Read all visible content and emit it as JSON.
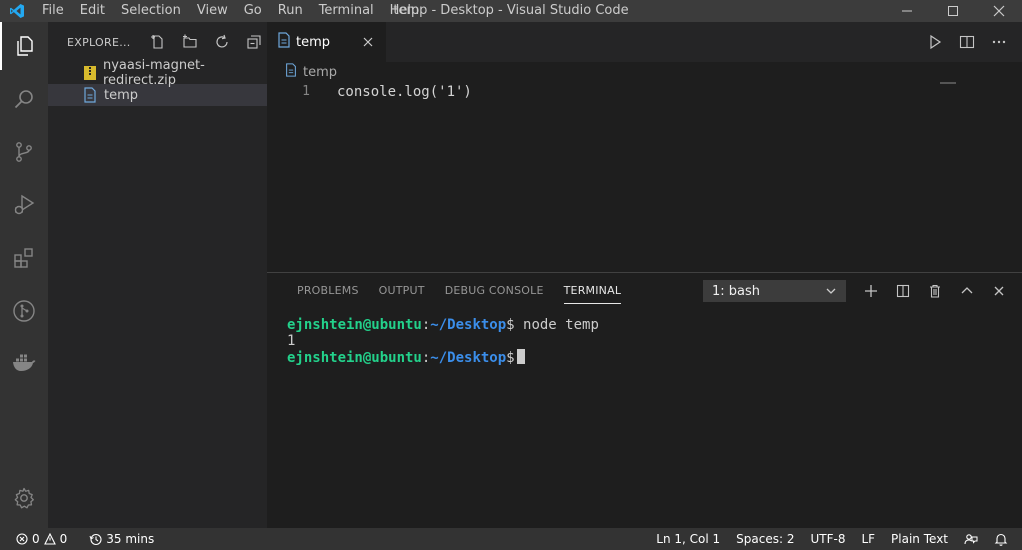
{
  "window": {
    "title": "temp - Desktop - Visual Studio Code",
    "menu": [
      "File",
      "Edit",
      "Selection",
      "View",
      "Go",
      "Run",
      "Terminal",
      "Help"
    ]
  },
  "colors": {
    "accent": "#007acc",
    "activity_bar": "#333333",
    "sidebar": "#252526",
    "editor": "#1e1e1e",
    "terminal_user": "#23d18b",
    "terminal_path": "#3b8eea"
  },
  "activity_bar": {
    "items": [
      "files-icon",
      "search-icon",
      "source-control-icon",
      "run-debug-icon",
      "extensions-icon",
      "git-graph-icon",
      "docker-icon"
    ],
    "bottom": "settings-gear-icon"
  },
  "sidebar": {
    "title": "EXPLORE...",
    "files": [
      {
        "name": "nyaasi-magnet-redirect.zip",
        "icon": "zip-file-icon"
      },
      {
        "name": "temp",
        "icon": "file-icon"
      }
    ]
  },
  "editor": {
    "tab": "temp",
    "breadcrumb": "temp",
    "lines": [
      {
        "num": "1",
        "code": "console.log('1')"
      }
    ]
  },
  "panel": {
    "tabs": [
      "PROBLEMS",
      "OUTPUT",
      "DEBUG CONSOLE",
      "TERMINAL"
    ],
    "active_tab": "TERMINAL",
    "terminal_select": "1: bash",
    "terminal": {
      "user": "ejnshtein@ubuntu",
      "sep": ":",
      "path": "~/Desktop",
      "prompt": "$",
      "cmd1": " node temp",
      "output": "1"
    }
  },
  "statusbar": {
    "errors": "0",
    "warnings": "0",
    "time": "35 mins",
    "position": "Ln 1, Col 1",
    "spaces": "Spaces: 2",
    "encoding": "UTF-8",
    "eol": "LF",
    "language": "Plain Text"
  }
}
